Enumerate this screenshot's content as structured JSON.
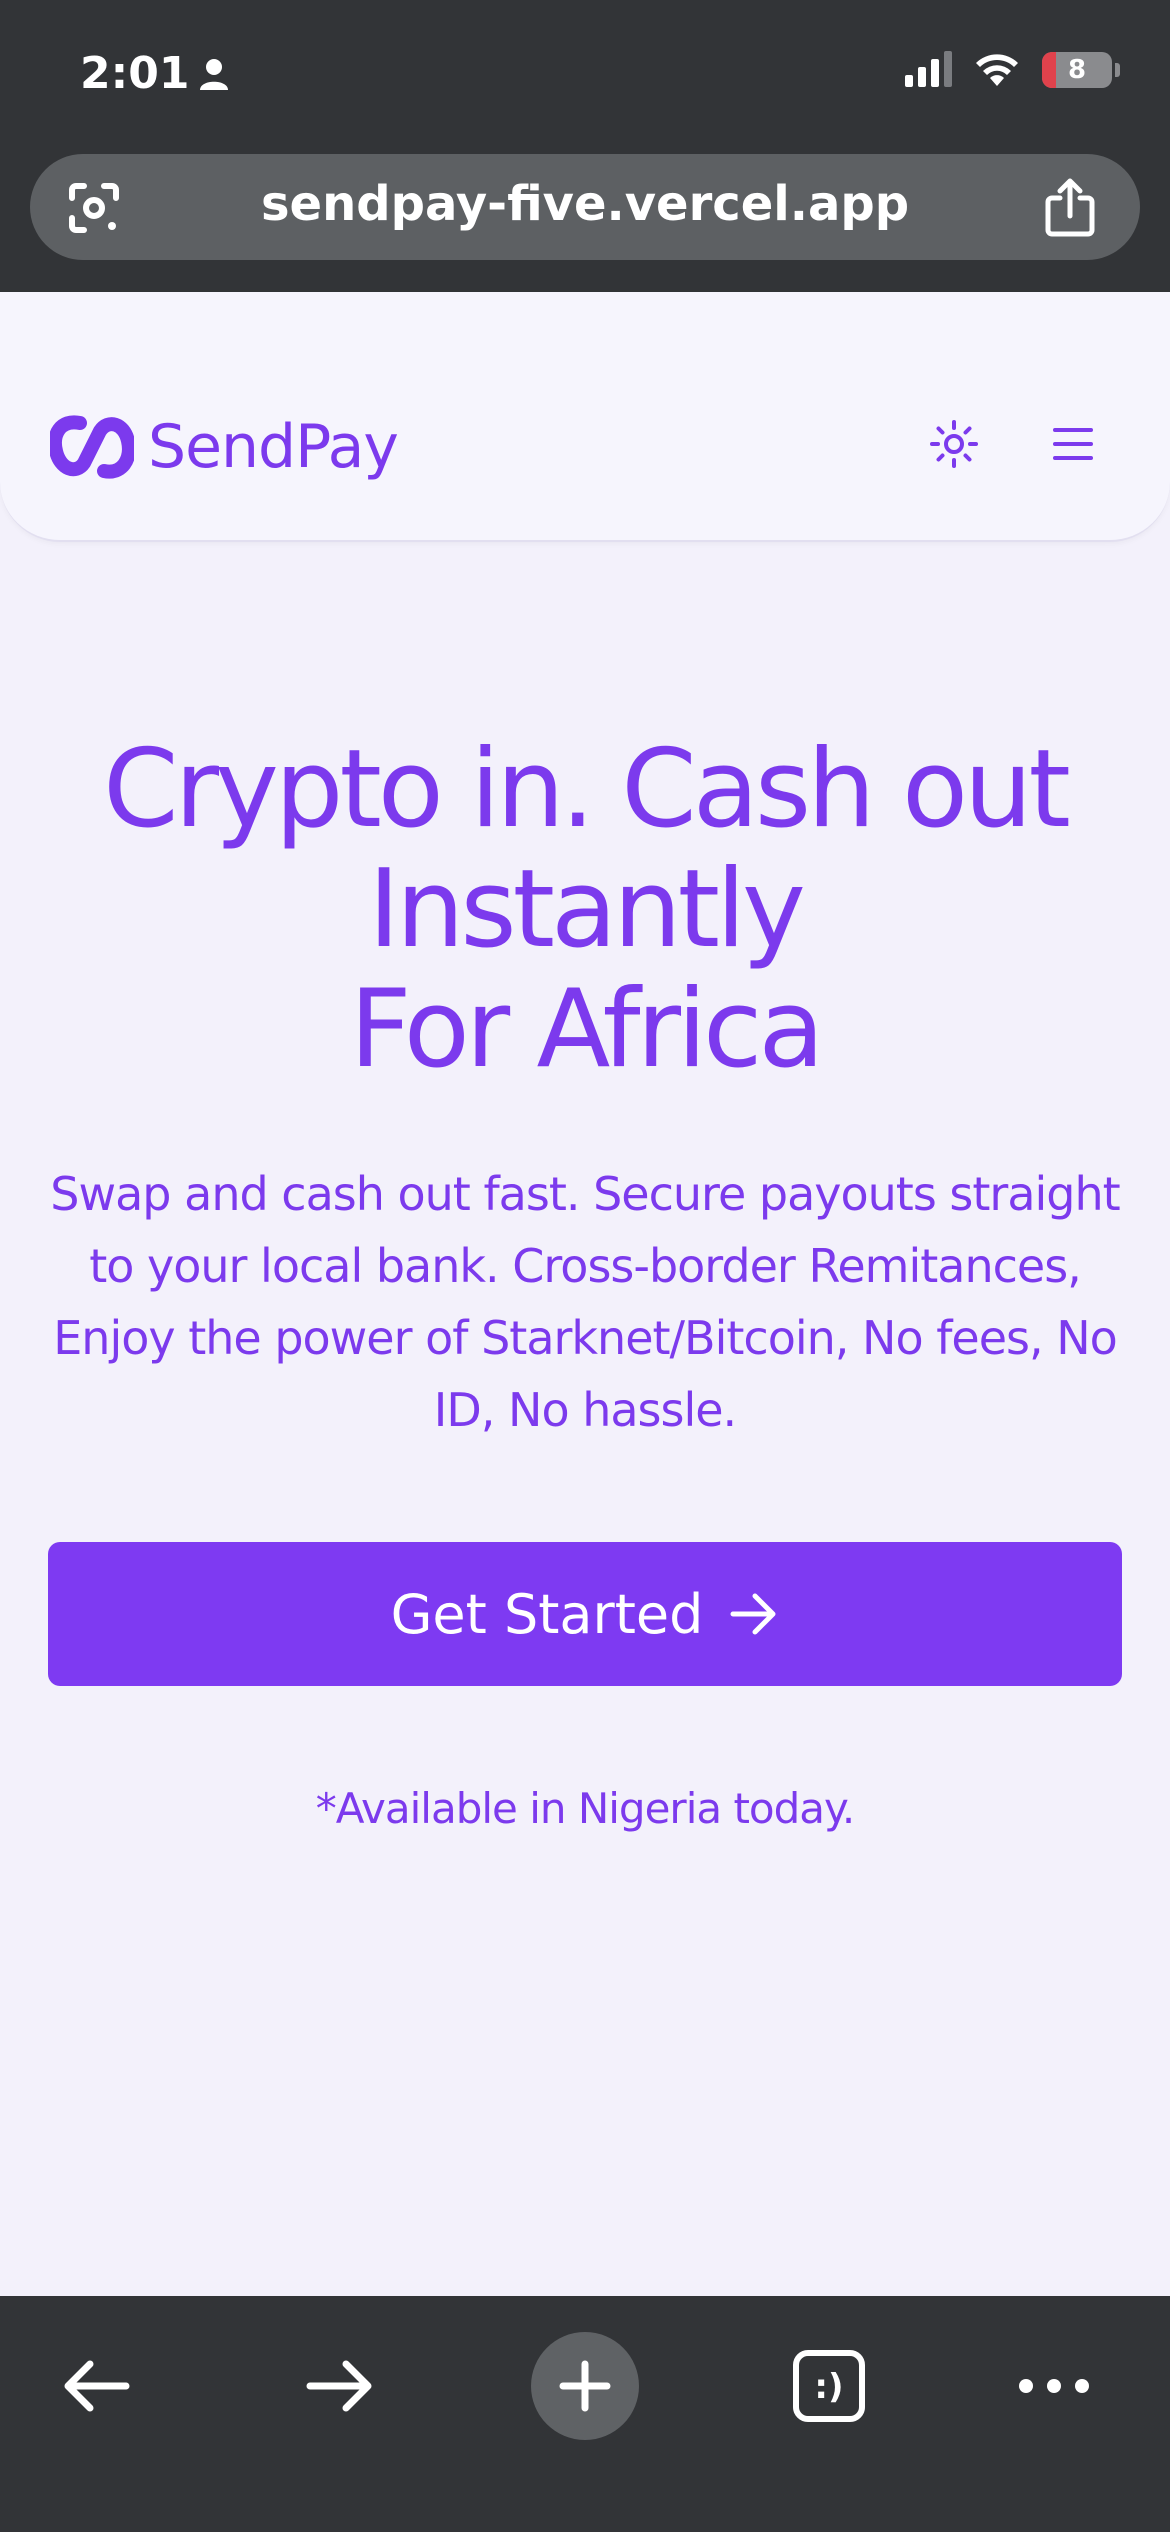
{
  "status_bar": {
    "time": "2:01",
    "battery": "8"
  },
  "browser": {
    "url": "sendpay-five.vercel.app"
  },
  "header": {
    "brand": "SendPay"
  },
  "hero": {
    "title_lines": [
      "Crypto in. Cash out",
      "Instantly",
      "For Africa"
    ],
    "subtitle": "Swap and cash out fast. Secure payouts straight to your local bank. Cross-border Remitances, Enjoy the power of Starknet/Bitcoin, No fees, No ID, No hassle.",
    "cta_label": "Get Started",
    "note": "*Available in Nigeria today."
  },
  "colors": {
    "accent": "#7c3aed",
    "button": "#7e3af2",
    "chrome": "#323437",
    "page_bg": "#f3f1fb"
  },
  "icons": [
    "person-icon",
    "signal-icon",
    "wifi-icon",
    "battery-icon",
    "google-lens-icon",
    "share-icon",
    "sendpay-logo-icon",
    "sun-icon",
    "menu-icon",
    "arrow-right-icon",
    "back-icon",
    "forward-icon",
    "new-tab-icon",
    "tabs-icon",
    "more-icon"
  ]
}
